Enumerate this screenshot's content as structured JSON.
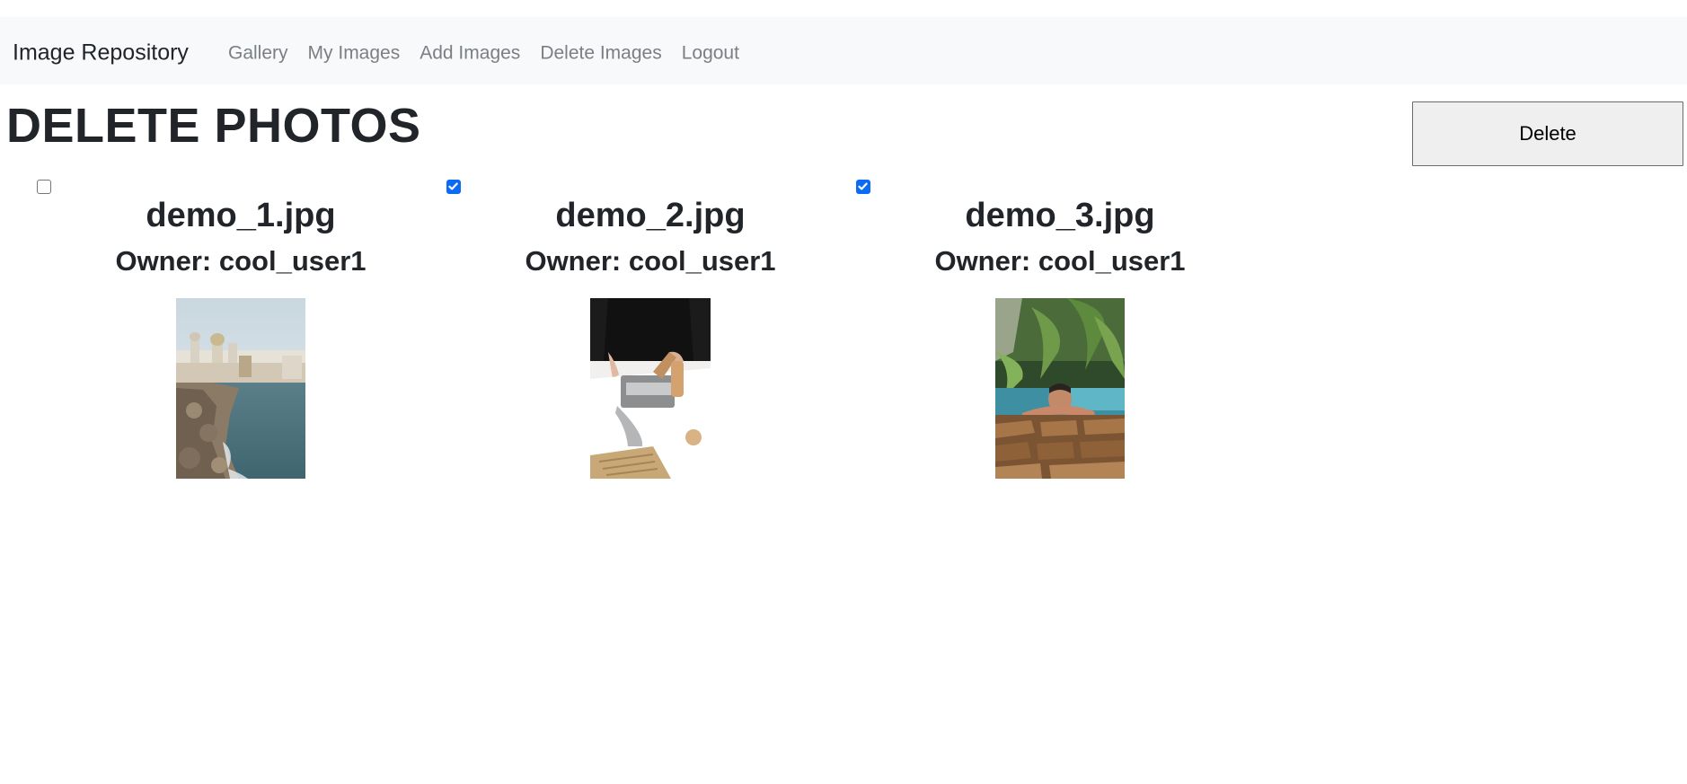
{
  "navbar": {
    "brand": "Image Repository",
    "links": [
      "Gallery",
      "My Images",
      "Add Images",
      "Delete Images",
      "Logout"
    ]
  },
  "page": {
    "title": "DELETE PHOTOS",
    "delete_label": "Delete"
  },
  "images": [
    {
      "name": "demo_1.jpg",
      "owner": "Owner: cool_user1",
      "checked": false,
      "depicts": "coastal city with cathedral and rocky seawall"
    },
    {
      "name": "demo_2.jpg",
      "owner": "Owner: cool_user1",
      "checked": true,
      "depicts": "person using a pasta machine on a white table"
    },
    {
      "name": "demo_3.jpg",
      "owner": "Owner: cool_user1",
      "checked": true,
      "depicts": "man leaning on the edge of a pool with palms behind"
    }
  ],
  "colors": {
    "navbar_bg": "#f8f9fa",
    "checkbox_checked": "#0b6bf5",
    "nav_link": "#7b7f83"
  }
}
